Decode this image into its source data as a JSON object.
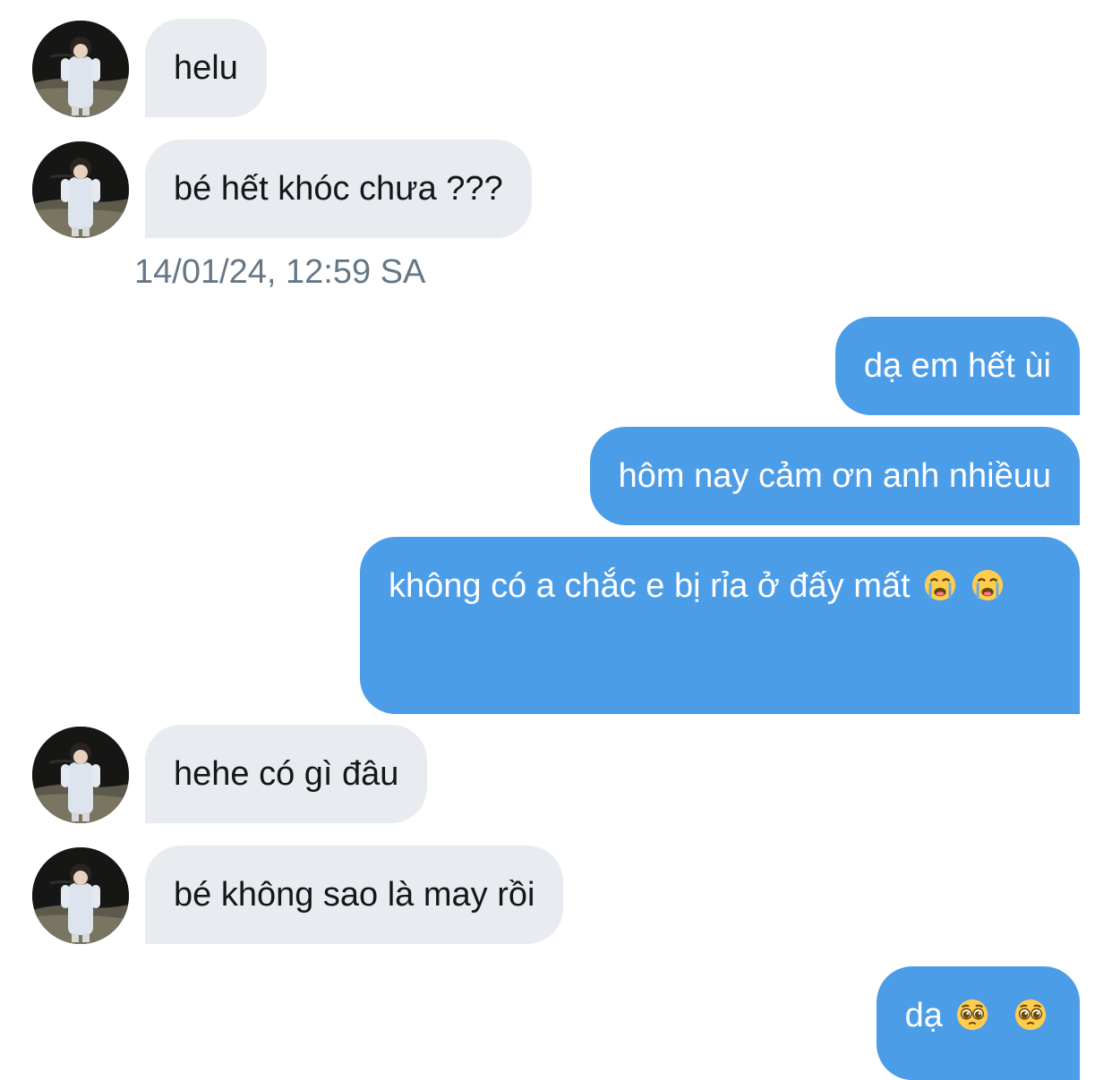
{
  "conversation": {
    "messages": [
      {
        "direction": "incoming",
        "text": "helu"
      },
      {
        "direction": "incoming",
        "text": "bé hết khóc chưa ???"
      },
      {
        "direction": "outgoing",
        "text": "dạ em hết ùi"
      },
      {
        "direction": "outgoing",
        "text": "hôm nay cảm ơn anh nhiềuu"
      },
      {
        "direction": "outgoing",
        "text": "không có a chắc e bị rỉa ở đấy mất",
        "emoji": [
          "loudly-crying-face",
          "loudly-crying-face"
        ]
      },
      {
        "direction": "incoming",
        "text": "hehe có gì đâu"
      },
      {
        "direction": "incoming",
        "text": "bé không sao là may rồi"
      },
      {
        "direction": "outgoing",
        "text": "dạ",
        "emoji": [
          "pleading-face",
          "pleading-face"
        ]
      }
    ],
    "timestamp": "14/01/24, 12:59 SA"
  },
  "colors": {
    "incoming_bubble": "#e8ebef",
    "outgoing_bubble": "#4c9de8",
    "timestamp_text": "#657786"
  }
}
